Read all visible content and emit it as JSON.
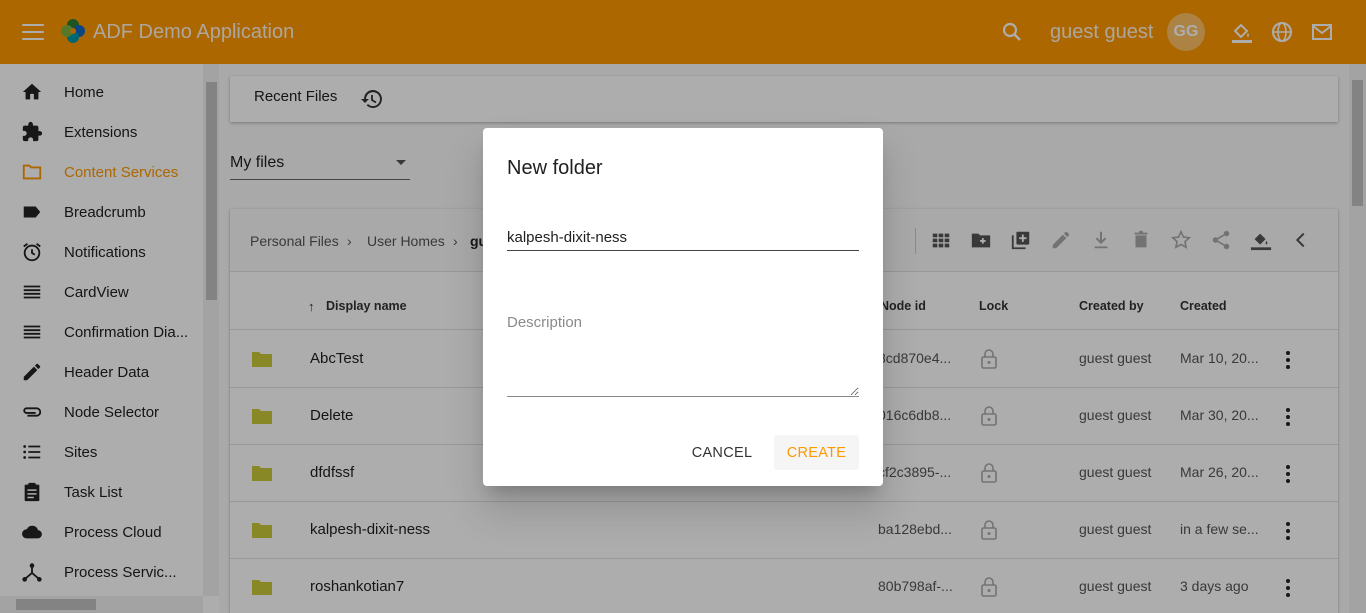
{
  "header": {
    "app_title": "ADF Demo Application",
    "user_name": "guest guest",
    "avatar_initials": "GG",
    "background_color": "#ff9800"
  },
  "sidebar": {
    "items": [
      {
        "label": "Home",
        "icon": "home-icon"
      },
      {
        "label": "Extensions",
        "icon": "puzzle-icon"
      },
      {
        "label": "Content Services",
        "icon": "folder-outline-icon",
        "active": true
      },
      {
        "label": "Breadcrumb",
        "icon": "label-icon"
      },
      {
        "label": "Notifications",
        "icon": "alarm-icon"
      },
      {
        "label": "CardView",
        "icon": "list-icon"
      },
      {
        "label": "Confirmation Dia...",
        "icon": "list-icon"
      },
      {
        "label": "Header Data",
        "icon": "pencil-icon"
      },
      {
        "label": "Node Selector",
        "icon": "attachment-icon"
      },
      {
        "label": "Sites",
        "icon": "bulleted-list-icon"
      },
      {
        "label": "Task List",
        "icon": "clipboard-icon"
      },
      {
        "label": "Process Cloud",
        "icon": "cloud-icon"
      },
      {
        "label": "Process Servic...",
        "icon": "device-hub-icon"
      }
    ],
    "active_color": "#ff9800"
  },
  "main": {
    "recent_files_label": "Recent Files",
    "select_value": "My files",
    "breadcrumb": [
      "Personal Files",
      "User Homes",
      "gu"
    ],
    "columns": {
      "display_name": "Display name",
      "node_id": "Node id",
      "lock": "Lock",
      "created_by": "Created by",
      "created": "Created"
    },
    "rows": [
      {
        "name": "AbcTest",
        "node_id": "8cd870e4...",
        "created_by": "guest guest",
        "created": "Mar 10, 20..."
      },
      {
        "name": "Delete",
        "node_id": "016c6db8...",
        "created_by": "guest guest",
        "created": "Mar 30, 20..."
      },
      {
        "name": "dfdfssf",
        "node_id": "cf2c3895-...",
        "created_by": "guest guest",
        "created": "Mar 26, 20..."
      },
      {
        "name": "kalpesh-dixit-ness",
        "node_id": "ba128ebd...",
        "created_by": "guest guest",
        "created": "in a few se..."
      },
      {
        "name": "roshankotian7",
        "node_id": "80b798af-...",
        "created_by": "guest guest",
        "created": "3 days ago"
      }
    ]
  },
  "dialog": {
    "title": "New folder",
    "name_value": "kalpesh-dixit-ness",
    "description_placeholder": "Description",
    "cancel_label": "CANCEL",
    "create_label": "CREATE"
  }
}
